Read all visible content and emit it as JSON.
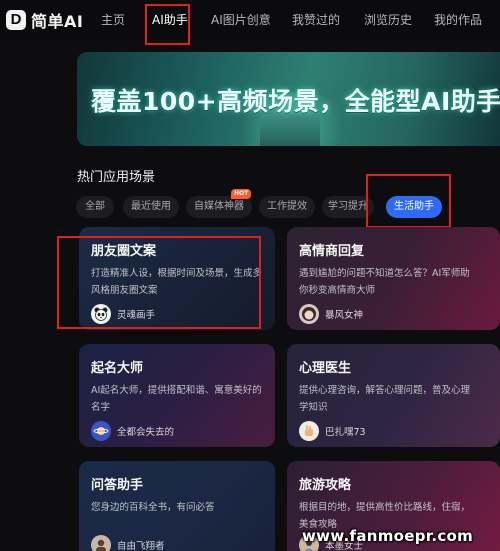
{
  "brand": {
    "logo_letter": "D",
    "name": "简单AI"
  },
  "nav": {
    "items": [
      {
        "label": "主页",
        "active": false
      },
      {
        "label": "AI助手",
        "active": true
      },
      {
        "label": "AI图片创意",
        "active": false
      },
      {
        "label": "我赞过的",
        "active": false
      },
      {
        "label": "浏览历史",
        "active": false
      },
      {
        "label": "我的作品",
        "active": false
      }
    ]
  },
  "banner": {
    "title": "覆盖100+高频场景，全能型AI助手"
  },
  "section": {
    "title": "热门应用场景"
  },
  "tabs": [
    {
      "label": "全部",
      "active": false
    },
    {
      "label": "最近使用",
      "active": false
    },
    {
      "label": "自媒体神器",
      "active": false,
      "badge": "HOT"
    },
    {
      "label": "工作提效",
      "active": false
    },
    {
      "label": "学习提升",
      "active": false
    },
    {
      "label": "生活助手",
      "active": true
    }
  ],
  "cards": [
    {
      "title": "朋友圈文案",
      "desc": "打造精准人设，根据时间及场景，生成多风格朋友圈文案",
      "author": "灵魂画手",
      "avatar_icon": "panda-avatar-icon"
    },
    {
      "title": "高情商回复",
      "desc": "遇到尴尬的问题不知道怎么答？AI军师助你秒变高情商大师",
      "author": "暴风女神",
      "avatar_icon": "girl-avatar-icon"
    },
    {
      "title": "起名大师",
      "desc": "AI起名大师，提供搭配和谐、寓意美好的名字",
      "author": "全都会失去的",
      "avatar_icon": "planet-avatar-icon"
    },
    {
      "title": "心理医生",
      "desc": "提供心理咨询，解答心理问题，普及心理学知识",
      "author": "巴扎嘿73",
      "avatar_icon": "hand-avatar-icon"
    },
    {
      "title": "问答助手",
      "desc": "您身边的百科全书，有问必答",
      "author": "自由飞翔者",
      "avatar_icon": "person-avatar-icon"
    },
    {
      "title": "旅游攻略",
      "desc": "根据目的地，提供高性价比路线，住宿，美食攻略",
      "author": "本墨女士",
      "avatar_icon": "traveler-avatar-icon"
    }
  ],
  "watermark": "www.fanmoepr.com",
  "colors": {
    "accent": "#2e6bf5",
    "highlight_box": "#e21f1f",
    "hot_badge": "#ff5a2a",
    "background": "#0d0d10"
  }
}
